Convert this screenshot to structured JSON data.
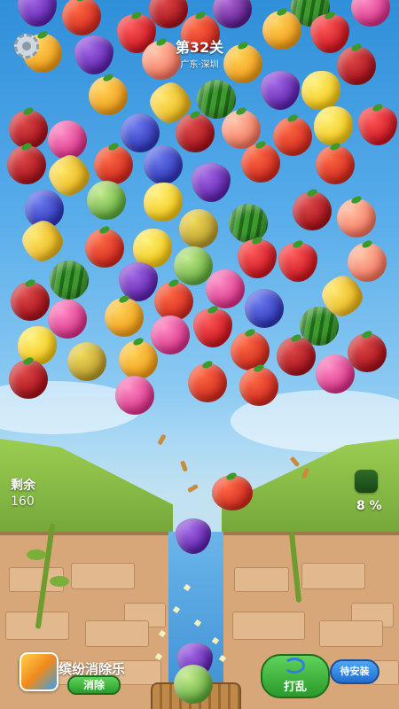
{
  "level": {
    "title": "第32关",
    "location": "广东·深圳"
  },
  "hud": {
    "remaining_label": "剩余",
    "remaining_value": "160",
    "progress_value": "8 %"
  },
  "ad_banner": {
    "app_name": "缤纷消除乐",
    "action_label": "消除"
  },
  "buttons": {
    "shuffle": "打乱",
    "pending_install": "待安装"
  },
  "colors": {
    "sky_top": "#2f8fd9",
    "grass": "#8cbc4a",
    "wall": "#d7a77a",
    "button_green": "#2a9a2a",
    "button_blue": "#1e6fd0"
  },
  "board": {
    "fruits": [
      "purple-cabbage",
      "tomato",
      "pomegranate",
      "plum",
      "watermelon",
      "dragonfruit",
      "orange",
      "strawberry",
      "grape",
      "peach",
      "tomato",
      "orange",
      "strawberry",
      "orange",
      "apple",
      "orange",
      "banana",
      "watermelon",
      "grape",
      "lemon",
      "apple",
      "dragonfruit",
      "blueberry",
      "pomegranate",
      "peach",
      "tomato",
      "lemon",
      "strawberry",
      "apple",
      "banana",
      "tomato",
      "blueberry",
      "grape",
      "tomato",
      "tomato",
      "blueberry",
      "cabbage",
      "lemon",
      "durian",
      "watermelon",
      "apple",
      "peach",
      "banana",
      "tomato",
      "lemon",
      "cabbage",
      "strawberry",
      "strawberry",
      "peach",
      "watermelon",
      "grape",
      "dragonfruit",
      "apple",
      "dragonfruit",
      "orange",
      "tomato",
      "strawberry",
      "blueberry",
      "watermelon",
      "banana",
      "lemon",
      "durian",
      "orange",
      "dragonfruit",
      "tomato",
      "apple",
      "apple",
      "apple",
      "dragonfruit",
      "tomato",
      "tomato",
      "dragonfruit"
    ],
    "shooter": {
      "current": "tomato",
      "next": "grape"
    },
    "basket": [
      "grape",
      "cabbage"
    ]
  }
}
